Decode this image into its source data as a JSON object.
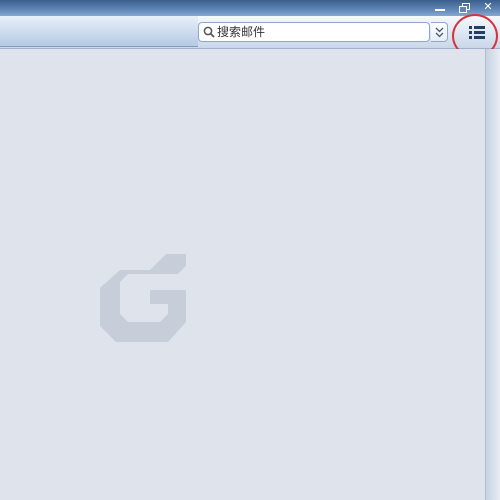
{
  "window_controls": {
    "minimize_icon": "minimize-icon",
    "restore_icon": "restore-icon",
    "close_icon": "close-icon",
    "close_glyph": "✕"
  },
  "toolbar": {
    "search_placeholder": "搜索邮件",
    "expand_icon": "double-chevron-down-icon",
    "expand_glyph": "≫",
    "menu_icon": "list-menu-icon"
  },
  "annotation": {
    "circle_color": "#d8333a"
  },
  "content": {
    "watermark_logo": "G"
  }
}
